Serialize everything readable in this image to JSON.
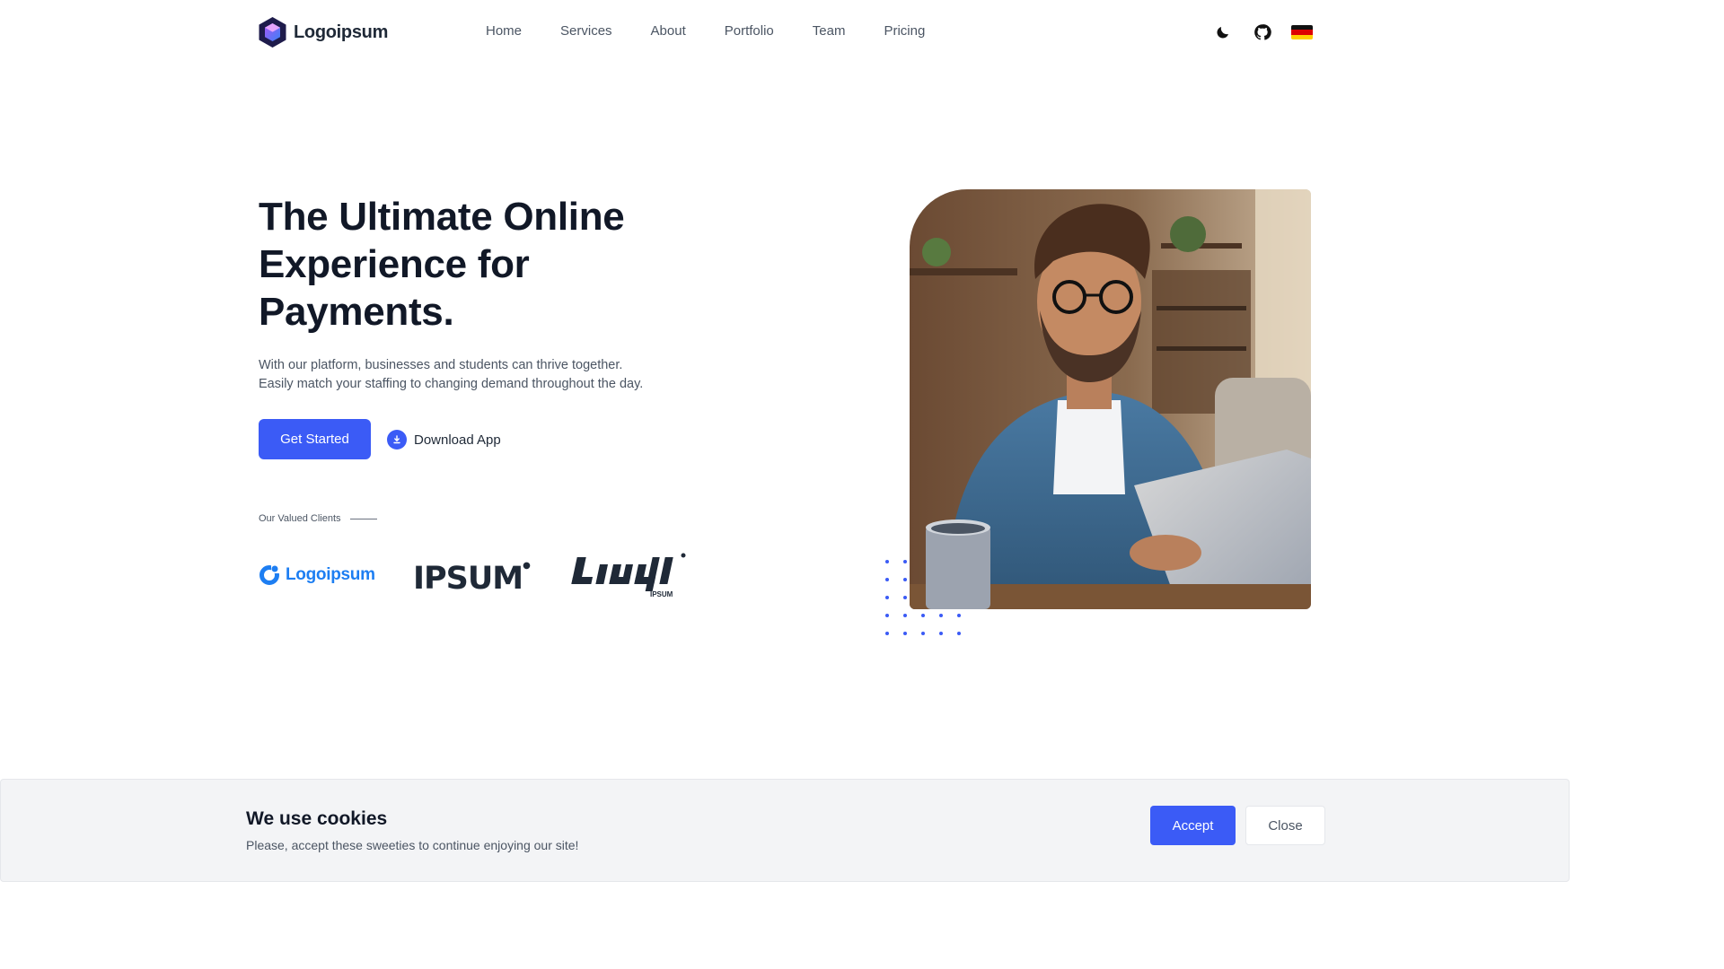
{
  "header": {
    "brand": "Logoipsum",
    "nav": [
      "Home",
      "Services",
      "About",
      "Portfolio",
      "Team",
      "Pricing"
    ],
    "actions": {
      "theme_icon": "moon-icon",
      "github_icon": "github-icon",
      "language_icon": "german-flag-icon"
    }
  },
  "hero": {
    "title": "The Ultimate Online Experience for Payments.",
    "subtitle_line1": "With our platform, businesses and students can thrive together.",
    "subtitle_line2": "Easily match your staffing to changing demand throughout the day.",
    "primary_cta": "Get Started",
    "secondary_cta": "Download App",
    "clients_label": "Our Valued Clients",
    "client_logos": {
      "logo1": "Logoipsum",
      "logo2": "IPSUM",
      "logo3": "IPSUM"
    },
    "photo_icon": "man-with-laptop-photo"
  },
  "cookie": {
    "title": "We use cookies",
    "text": "Please, accept these sweeties to continue enjoying our site!",
    "accept": "Accept",
    "close": "Close"
  },
  "colors": {
    "accent": "#3b5bf6",
    "heading": "#111827",
    "body_text": "#4b5563",
    "client_blue": "#1d7ef2",
    "banner_bg": "#f3f4f6"
  }
}
